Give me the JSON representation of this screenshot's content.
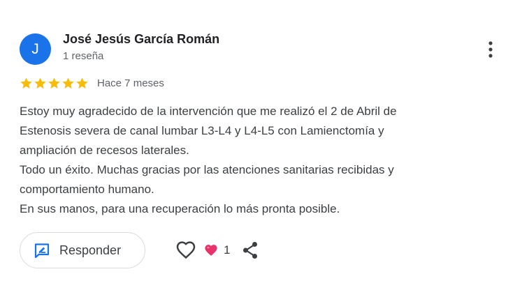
{
  "review": {
    "author": {
      "initial": "J",
      "name": "José Jesús García Román",
      "reviews_count": "1 reseña",
      "avatar_color": "#1a73e8"
    },
    "rating": 5,
    "rating_color": "#f9bc05",
    "time_ago": "Hace 7 meses",
    "text_lines": [
      "Estoy muy agradecido de la intervención que me realizó el 2 de Abril de",
      "Estenosis severa de canal lumbar L3-L4 y L4-L5 con Lamienctomía y",
      "ampliación de recesos laterales.",
      "Todo un éxito. Muchas gracias por las atenciones sanitarias recibidas y",
      "comportamiento humano.",
      "En sus manos, para una recuperación lo más pronta posible."
    ]
  },
  "actions": {
    "reply_label": "Responder",
    "reply_icon": "reply-icon",
    "like_icon": "heart-outline-icon",
    "reaction_icon": "heart-filled-icon",
    "reaction_count": "1",
    "share_icon": "share-icon",
    "menu_icon": "more-vert-icon",
    "accent_color": "#1a73e8",
    "reaction_color": "#e8326a"
  }
}
